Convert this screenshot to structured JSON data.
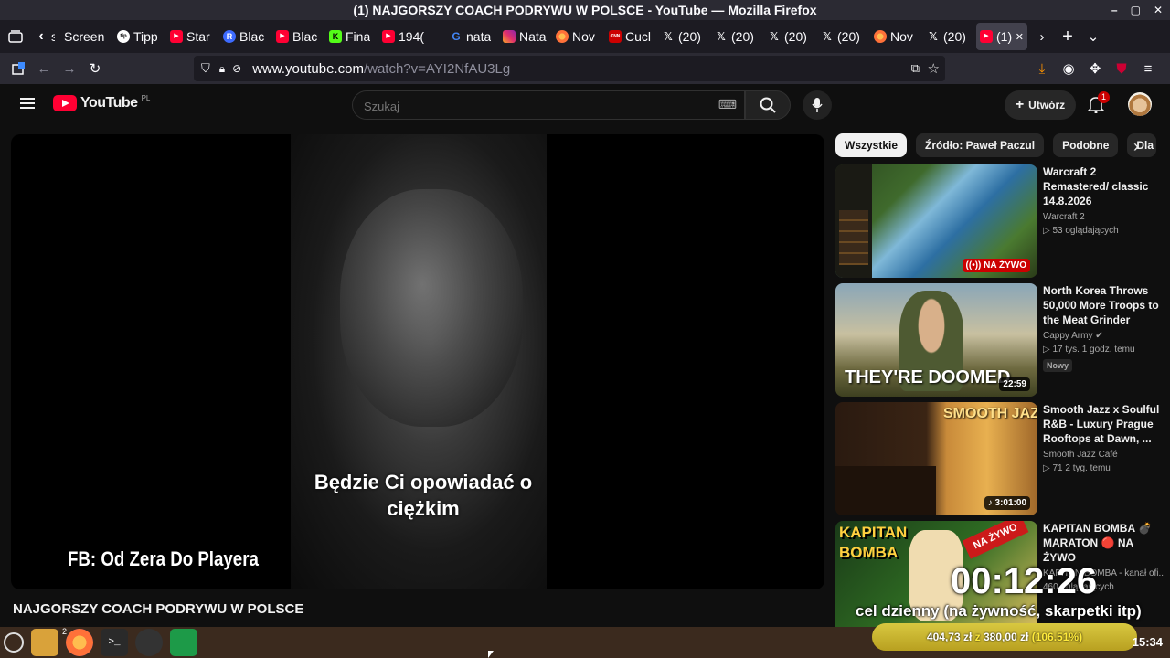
{
  "window": {
    "title": "(1) NAJGORSZY COACH PODRYWU W POLSCE - YouTube — Mozilla Firefox",
    "controls": [
      "–",
      "▢",
      "✕"
    ]
  },
  "tabs": [
    {
      "label": "sc",
      "icon": "chevron-left-icon",
      "color": "#fbfbfe"
    },
    {
      "label": "Screen",
      "icon": "",
      "color": ""
    },
    {
      "label": "Tipp",
      "icon": "tip-icon",
      "color": "#ffffff"
    },
    {
      "label": "Star",
      "icon": "youtube-icon",
      "color": "#ff0033"
    },
    {
      "label": "Blac",
      "icon": "r-icon",
      "color": "#3d6bff"
    },
    {
      "label": "Blac",
      "icon": "youtube-icon",
      "color": "#ff0033"
    },
    {
      "label": "Fina",
      "icon": "k-icon",
      "color": "#53fc18"
    },
    {
      "label": "194(",
      "icon": "youtube-icon",
      "color": "#ff0033"
    },
    {
      "label": "nata",
      "icon": "google-icon",
      "color": "#4285f4"
    },
    {
      "label": "Nata",
      "icon": "instagram-icon",
      "color": "#e1306c"
    },
    {
      "label": "Nov",
      "icon": "firefox-icon",
      "color": "#ff7139"
    },
    {
      "label": "Cucl",
      "icon": "cnn-icon",
      "color": "#cc0000"
    },
    {
      "label": "(20)",
      "icon": "x-icon",
      "color": "#ffffff"
    },
    {
      "label": "(20)",
      "icon": "x-icon",
      "color": "#ffffff"
    },
    {
      "label": "(20)",
      "icon": "x-icon",
      "color": "#ffffff"
    },
    {
      "label": "(20)",
      "icon": "x-icon",
      "color": "#ffffff"
    },
    {
      "label": "Nov",
      "icon": "firefox-icon",
      "color": "#ff7139"
    },
    {
      "label": "(20)",
      "icon": "x-icon",
      "color": "#ffffff"
    },
    {
      "label": "(1)",
      "icon": "youtube-icon",
      "color": "#ff0033",
      "active": true
    }
  ],
  "nav": {
    "url_host": "www.youtube.com",
    "url_path": "/watch?v=AYI2NfAU3Lg"
  },
  "youtube": {
    "logo_text": "YouTube",
    "region": "PL",
    "search_placeholder": "Szukaj",
    "create_label": "Utwórz",
    "notification_count": "1",
    "video_title": "NAJGORSZY COACH PODRYWU W POLSCE",
    "caption_line1": "Będzie Ci opowiadać o",
    "caption_line2": "ciężkim",
    "watermark": "FB: Od Zera Do Playera",
    "chips": [
      "Wszystkie",
      "Źródło: Paweł Paczul",
      "Podobne",
      "Dla C"
    ],
    "recommendations": [
      {
        "title": "Warcraft 2 Remastered/ classic 14.8.2026",
        "channel": "Warcraft 2",
        "meta": "53 oglądających",
        "badge": "NA ŻYWO",
        "badge_type": "live"
      },
      {
        "title": "North Korea Throws 50,000 More Troops to the Meat Grinder",
        "channel": "Cappy Army",
        "meta": "17 tys.   1 godz. temu",
        "badge": "22:59",
        "tag": "Nowy",
        "overlay": "THEY'RE DOOMED"
      },
      {
        "title": "Smooth Jazz x Soulful R&B - Luxury Prague Rooftops at Dawn, ...",
        "channel": "Smooth Jazz Café",
        "meta": "71   2 tyg. temu",
        "badge": "3:01:00",
        "overlay": "SMOOTH JAZZ"
      },
      {
        "title": "KAPITAN BOMBA 💣 MARATON 🔴 NA ŻYWO",
        "channel": "KAPITAN BOMBA - kanał ofi...",
        "meta": "460 oglądających",
        "overlay": "KAPITAN BOMBA"
      }
    ]
  },
  "overlay": {
    "timer": "00:12:26",
    "goal_text": "cel dzienny (na żywność, skarpetki itp)",
    "progress_text_1": "404,73 zł",
    "progress_sep": "z",
    "progress_text_2": "380,00 zł",
    "progress_pct": "(106.51%)",
    "progress_fraction": 1.0
  },
  "taskbar": {
    "firefox_badge": "2",
    "clock": "15:34"
  }
}
